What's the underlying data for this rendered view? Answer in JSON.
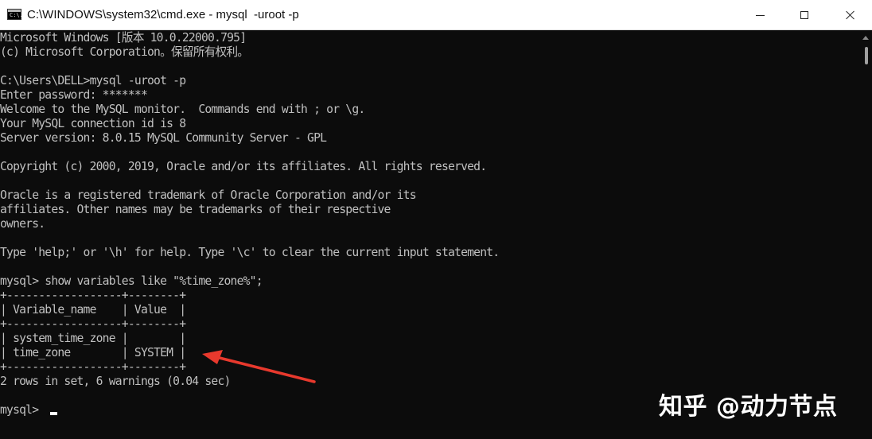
{
  "window": {
    "title": "C:\\WINDOWS\\system32\\cmd.exe - mysql  -uroot -p",
    "icon_name": "cmd-icon",
    "icon_text": "C:\\."
  },
  "console": {
    "lines": [
      "Microsoft Windows [版本 10.0.22000.795]",
      "(c) Microsoft Corporation。保留所有权利。",
      "",
      "C:\\Users\\DELL>mysql -uroot -p",
      "Enter password: *******",
      "Welcome to the MySQL monitor.  Commands end with ; or \\g.",
      "Your MySQL connection id is 8",
      "Server version: 8.0.15 MySQL Community Server - GPL",
      "",
      "Copyright (c) 2000, 2019, Oracle and/or its affiliates. All rights reserved.",
      "",
      "Oracle is a registered trademark of Oracle Corporation and/or its",
      "affiliates. Other names may be trademarks of their respective",
      "owners.",
      "",
      "Type 'help;' or '\\h' for help. Type '\\c' to clear the current input statement.",
      "",
      "mysql> show variables like \"%time_zone%\";",
      "+------------------+--------+",
      "| Variable_name    | Value  |",
      "+------------------+--------+",
      "| system_time_zone |        |",
      "| time_zone        | SYSTEM |",
      "+------------------+--------+",
      "2 rows in set, 6 warnings (0.04 sec)",
      "",
      "mysql> "
    ]
  },
  "watermark": {
    "text": "知乎 @动力节点"
  },
  "colors": {
    "console_bg": "#0c0c0c",
    "console_text": "#c0c0c0",
    "arrow": "#e8392d",
    "titlebar_bg": "#ffffff"
  }
}
